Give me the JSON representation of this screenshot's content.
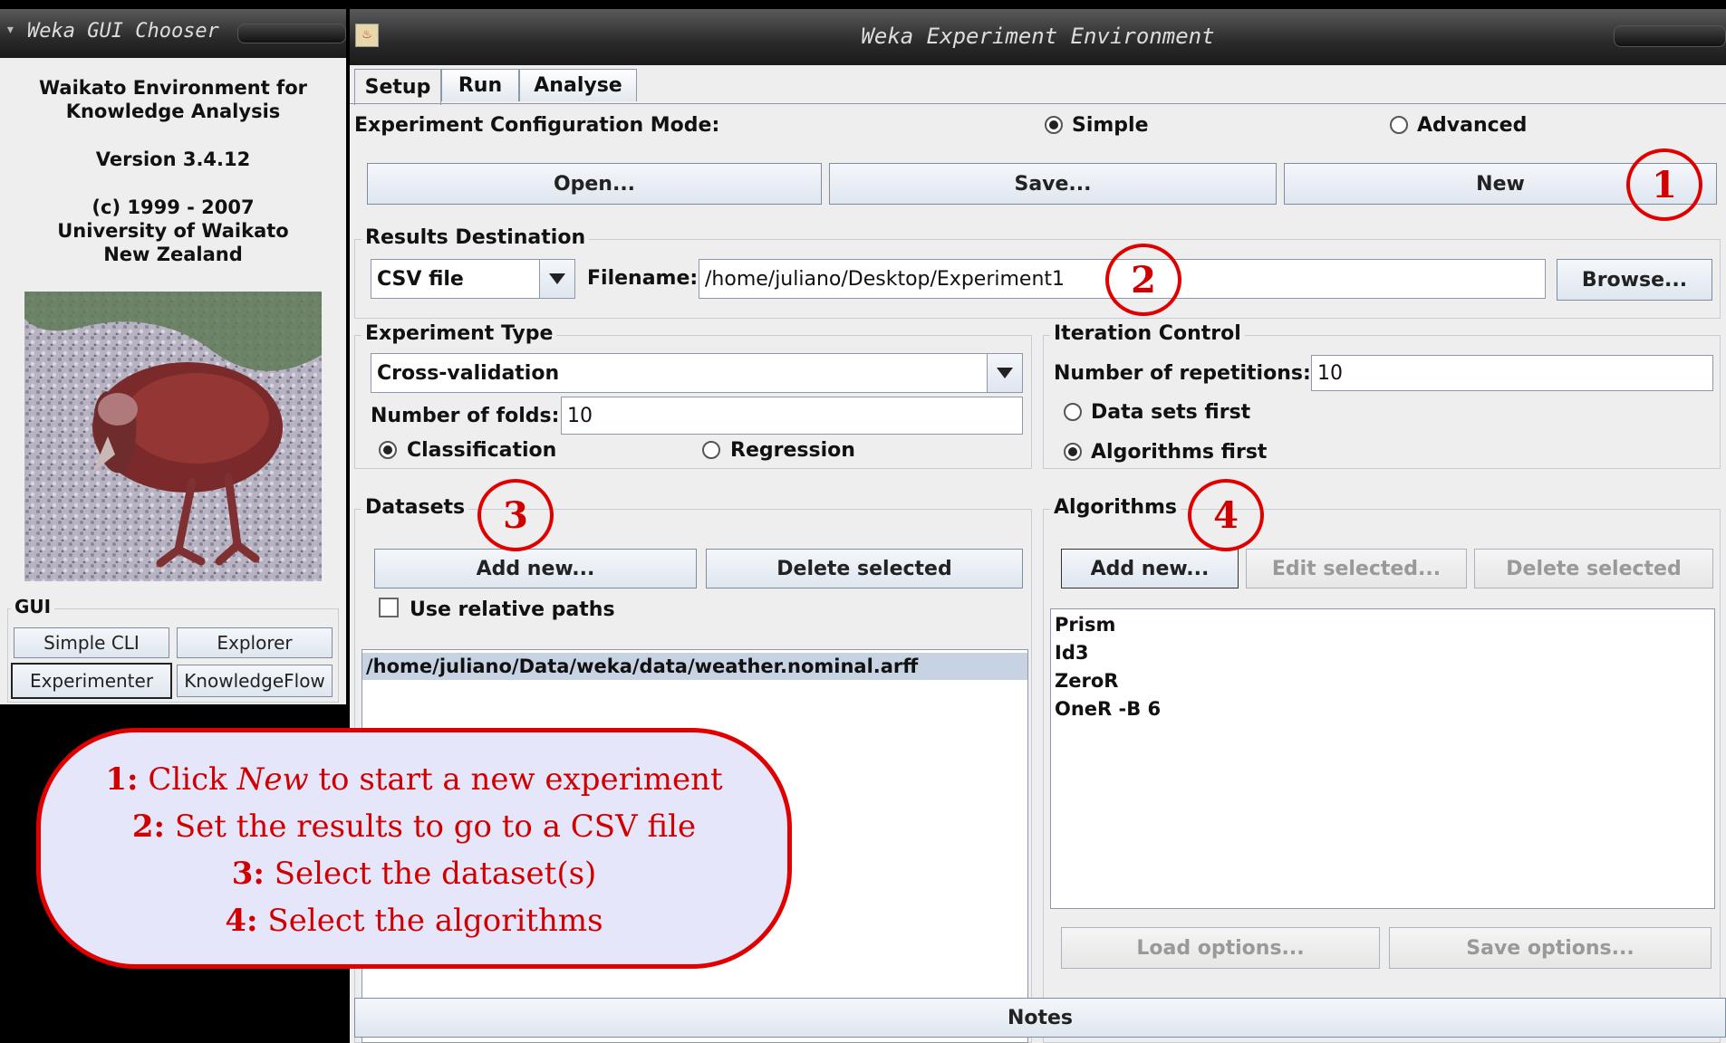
{
  "chooser": {
    "title": "Weka GUI Chooser",
    "about": {
      "line1": "Waikato Environment for",
      "line2": "Knowledge Analysis",
      "version": "Version 3.4.12",
      "copyright": "(c) 1999 - 2007",
      "org1": "University of Waikato",
      "org2": "New Zealand"
    },
    "gui_label": "GUI",
    "buttons": {
      "simple_cli": "Simple CLI",
      "explorer": "Explorer",
      "experimenter": "Experimenter",
      "knowledgeflow": "KnowledgeFlow"
    }
  },
  "experiment": {
    "title": "Weka Experiment Environment",
    "tabs": [
      "Setup",
      "Run",
      "Analyse"
    ],
    "config_mode_label": "Experiment Configuration Mode:",
    "mode_simple": "Simple",
    "mode_advanced": "Advanced",
    "open_btn": "Open...",
    "save_btn": "Save...",
    "new_btn": "New",
    "results": {
      "legend": "Results Destination",
      "type": "CSV file",
      "filename_label": "Filename:",
      "filename": "/home/juliano/Desktop/Experiment1",
      "browse_btn": "Browse..."
    },
    "exp_type": {
      "legend": "Experiment Type",
      "type": "Cross-validation",
      "folds_label": "Number of folds:",
      "folds": "10",
      "classification": "Classification",
      "regression": "Regression"
    },
    "iteration": {
      "legend": "Iteration Control",
      "reps_label": "Number of repetitions:",
      "reps": "10",
      "data_first": "Data sets first",
      "algos_first": "Algorithms first"
    },
    "datasets": {
      "legend": "Datasets",
      "add_btn": "Add new...",
      "delete_btn": "Delete selected",
      "relative_paths": "Use relative paths",
      "items": [
        "/home/juliano/Data/weka/data/weather.nominal.arff"
      ]
    },
    "algorithms": {
      "legend": "Algorithms",
      "add_btn": "Add new...",
      "edit_btn": "Edit selected...",
      "delete_btn": "Delete selected",
      "items": [
        "Prism",
        "Id3",
        "ZeroR",
        "OneR -B 6"
      ],
      "load_btn": "Load options...",
      "save_btn": "Save options..."
    },
    "notes_btn": "Notes"
  },
  "annotations": {
    "c1": "1",
    "c2": "2",
    "c3": "3",
    "c4": "4",
    "callout": {
      "l1_num": "1:",
      "l1_pre": "Click",
      "l1_em": "New",
      "l1_post": "to start a new experiment",
      "l2_num": "2:",
      "l2_text": "Set the results to go to a CSV file",
      "l3_num": "3:",
      "l3_text": "Select the dataset(s)",
      "l4_num": "4:",
      "l4_text": "Select the algorithms"
    }
  },
  "colors": {
    "annotation_red": "#e00000",
    "callout_fill": "#e6e6fb"
  }
}
